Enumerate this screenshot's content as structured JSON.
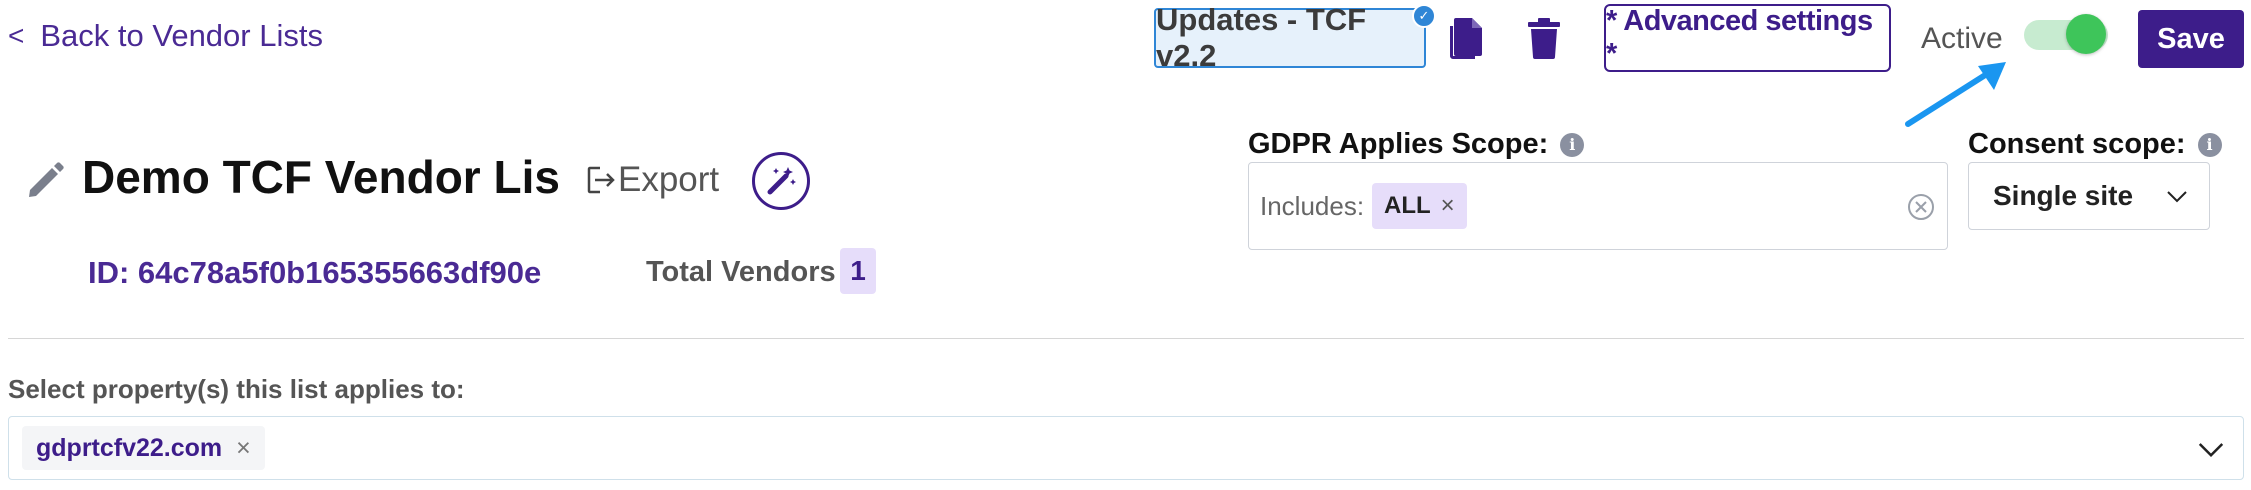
{
  "nav": {
    "back_label": "Back to Vendor Lists",
    "back_chevron": "<"
  },
  "toolbar": {
    "updates_label": "Updates - TCF v2.2",
    "updates_badge": "✓",
    "advanced_settings_label": "* Advanced settings *",
    "active_label": "Active",
    "active_on": true,
    "save_label": "Save",
    "icons": [
      "copy-icon",
      "trash-icon"
    ]
  },
  "header": {
    "title": "Demo TCF Vendor List",
    "export_label": "Export",
    "id_text": "ID: 64c78a5f0b165355663df90e",
    "total_vendors_label": "Total Vendors",
    "total_vendors_value": "1"
  },
  "gdpr_scope": {
    "label": "GDPR Applies Scope:",
    "includes_label": "Includes:",
    "tags": [
      "ALL"
    ]
  },
  "consent_scope": {
    "label": "Consent scope:",
    "selected": "Single site"
  },
  "properties": {
    "label": "Select property(s) this list applies to:",
    "tags": [
      "gdprtcfv22.com"
    ]
  },
  "colors": {
    "brand": "#3d1d8a",
    "toggle_on": "#3ec55a",
    "updates_border": "#2f86d6",
    "tag_bg": "#e6ddfa"
  }
}
